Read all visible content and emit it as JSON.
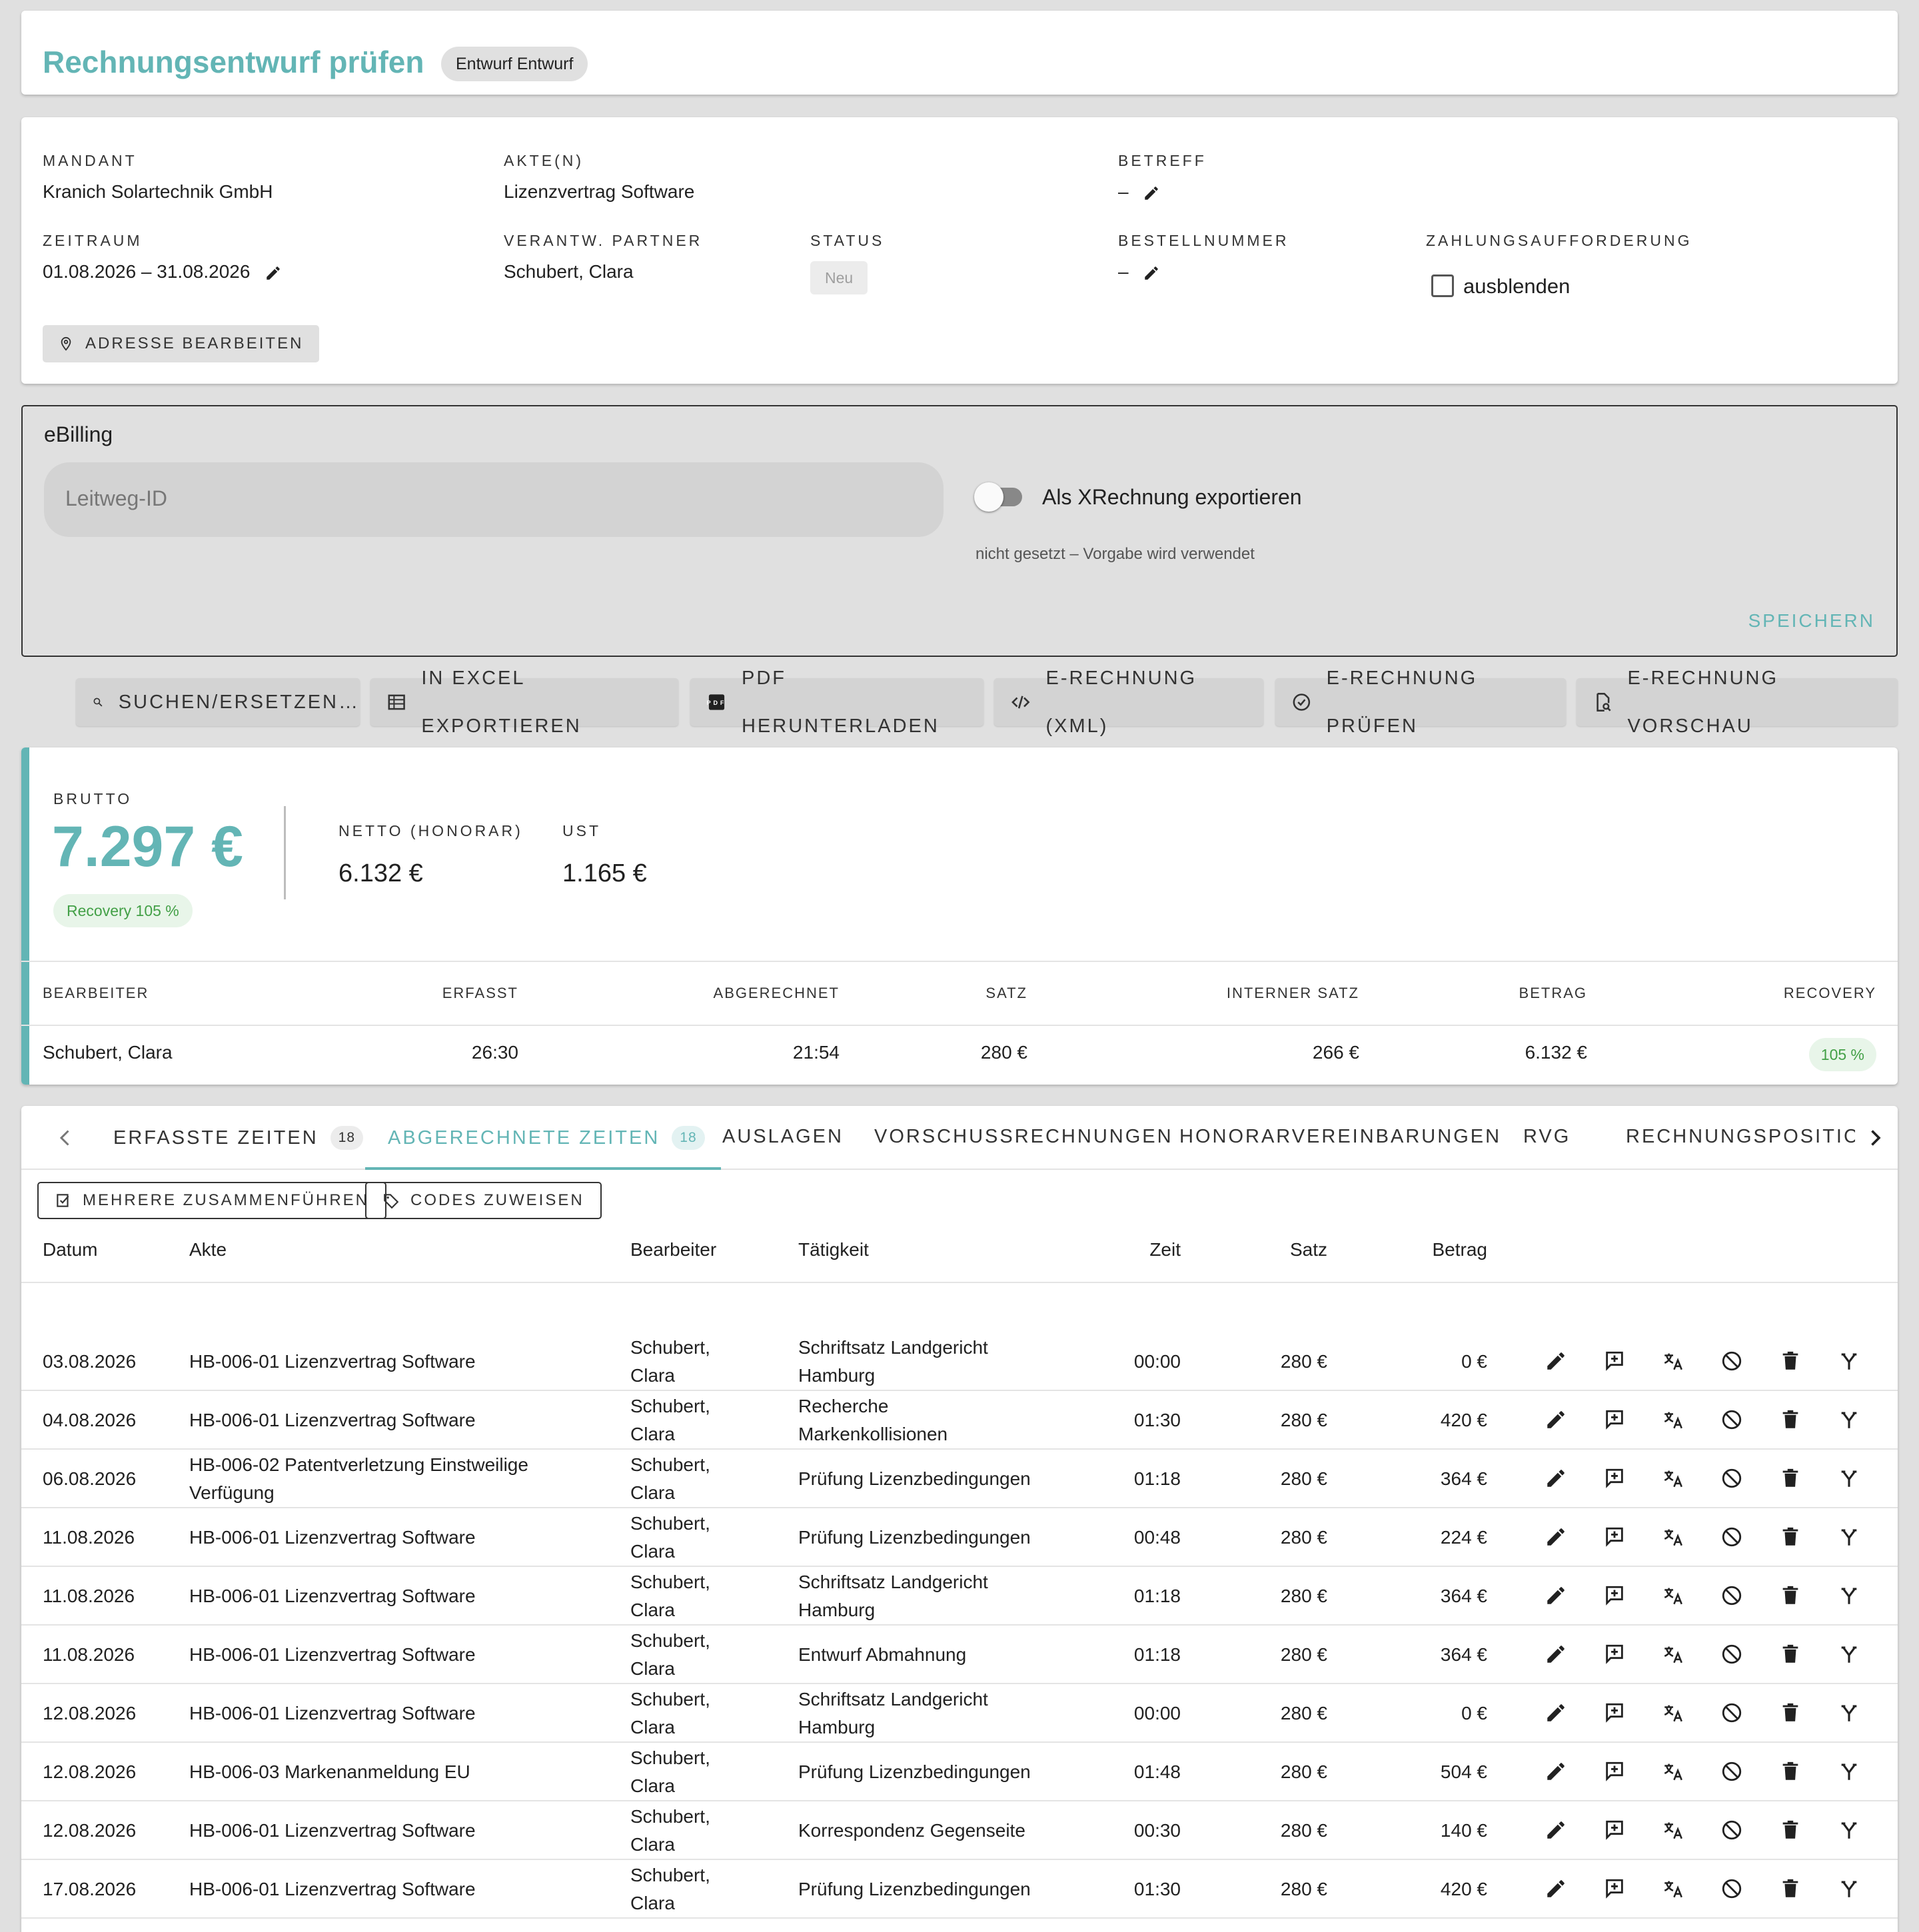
{
  "header": {
    "title": "Rechnungsentwurf prüfen",
    "draft_chip": "Entwurf Entwurf"
  },
  "meta": {
    "mandant_label": "MANDANT",
    "mandant_value": "Kranich Solartechnik GmbH",
    "akten_label": "AKTE(N)",
    "akten_value": "Lizenzvertrag Software",
    "betreff_label": "BETREFF",
    "betreff_value": "–",
    "zeitraum_label": "ZEITRAUM",
    "zeitraum_value": "01.08.2026 – 31.08.2026",
    "partner_label": "VERANTW. PARTNER",
    "partner_value": "Schubert, Clara",
    "status_label": "STATUS",
    "status_value": "Neu",
    "bestell_label": "BESTELLNUMMER",
    "bestell_value": "–",
    "zahlung_label": "ZAHLUNGSAUFFORDERUNG",
    "zahlung_checkbox_label": "ausblenden",
    "address_button": "ADRESSE BEARBEITEN"
  },
  "ebilling": {
    "title": "eBilling",
    "leitweg_placeholder": "Leitweg-ID",
    "xrechnung_label": "Als XRechnung exportieren",
    "xrechnung_hint": "nicht gesetzt – Vorgabe wird verwendet",
    "save_label": "SPEICHERN"
  },
  "toolbar": {
    "search_replace": "SUCHEN/ERSETZEN…",
    "excel_export": "IN EXCEL EXPORTIEREN",
    "pdf_download": "PDF HERUNTERLADEN",
    "erechnung_xml": "E-RECHNUNG (XML)",
    "erechnung_check": "E-RECHNUNG PRÜFEN",
    "erechnung_preview": "E-RECHNUNG VORSCHAU"
  },
  "totals": {
    "brutto_label": "BRUTTO",
    "brutto_value": "7.297 €",
    "recovery_chip": "Recovery 105 %",
    "netto_label": "NETTO (HONORAR)",
    "netto_value": "6.132 €",
    "ust_label": "UST",
    "ust_value": "1.165 €",
    "columns": [
      "BEARBEITER",
      "ERFASST",
      "ABGERECHNET",
      "SATZ",
      "INTERNER SATZ",
      "BETRAG",
      "RECOVERY"
    ],
    "row": {
      "bearbeiter": "Schubert, Clara",
      "erfasst": "26:30",
      "abgerechnet": "21:54",
      "satz": "280 €",
      "interner_satz": "266 €",
      "betrag": "6.132 €",
      "recovery": "105 %"
    }
  },
  "tabs": [
    {
      "label": "ERFASSTE ZEITEN",
      "count": "18"
    },
    {
      "label": "ABGERECHNETE ZEITEN",
      "count": "18"
    },
    {
      "label": "AUSLAGEN"
    },
    {
      "label": "VORSCHUSSRECHNUNGEN"
    },
    {
      "label": "HONORARVEREINBARUNGEN"
    },
    {
      "label": "RVG"
    },
    {
      "label": "RECHNUNGSPOSITIC"
    }
  ],
  "actions": {
    "merge": "MEHRERE ZUSAMMENFÜHREN",
    "codes": "CODES ZUWEISEN"
  },
  "table": {
    "headers": {
      "datum": "Datum",
      "akte": "Akte",
      "bearbeiter": "Bearbeiter",
      "taetigkeit": "Tätigkeit",
      "zeit": "Zeit",
      "satz": "Satz",
      "betrag": "Betrag"
    },
    "rows": [
      {
        "datum": "03.08.2026",
        "akte": "HB-006-01 Lizenzvertrag Software",
        "bearbeiter": "Schubert, Clara",
        "taetigkeit": "Schriftsatz Landgericht Hamburg",
        "zeit": "00:00",
        "satz": "280 €",
        "betrag": "0 €"
      },
      {
        "datum": "04.08.2026",
        "akte": "HB-006-01 Lizenzvertrag Software",
        "bearbeiter": "Schubert, Clara",
        "taetigkeit": "Recherche Markenkollisionen",
        "zeit": "01:30",
        "satz": "280 €",
        "betrag": "420 €"
      },
      {
        "datum": "06.08.2026",
        "akte": "HB-006-02 Patentverletzung Einstweilige Verfügung",
        "bearbeiter": "Schubert, Clara",
        "taetigkeit": "Prüfung Lizenzbedingungen",
        "zeit": "01:18",
        "satz": "280 €",
        "betrag": "364 €"
      },
      {
        "datum": "11.08.2026",
        "akte": "HB-006-01 Lizenzvertrag Software",
        "bearbeiter": "Schubert, Clara",
        "taetigkeit": "Prüfung Lizenzbedingungen",
        "zeit": "00:48",
        "satz": "280 €",
        "betrag": "224 €"
      },
      {
        "datum": "11.08.2026",
        "akte": "HB-006-01 Lizenzvertrag Software",
        "bearbeiter": "Schubert, Clara",
        "taetigkeit": "Schriftsatz Landgericht Hamburg",
        "zeit": "01:18",
        "satz": "280 €",
        "betrag": "364 €"
      },
      {
        "datum": "11.08.2026",
        "akte": "HB-006-01 Lizenzvertrag Software",
        "bearbeiter": "Schubert, Clara",
        "taetigkeit": "Entwurf Abmahnung",
        "zeit": "01:18",
        "satz": "280 €",
        "betrag": "364 €"
      },
      {
        "datum": "12.08.2026",
        "akte": "HB-006-01 Lizenzvertrag Software",
        "bearbeiter": "Schubert, Clara",
        "taetigkeit": "Schriftsatz Landgericht Hamburg",
        "zeit": "00:00",
        "satz": "280 €",
        "betrag": "0 €"
      },
      {
        "datum": "12.08.2026",
        "akte": "HB-006-03 Markenanmeldung EU",
        "bearbeiter": "Schubert, Clara",
        "taetigkeit": "Prüfung Lizenzbedingungen",
        "zeit": "01:48",
        "satz": "280 €",
        "betrag": "504 €"
      },
      {
        "datum": "12.08.2026",
        "akte": "HB-006-01 Lizenzvertrag Software",
        "bearbeiter": "Schubert, Clara",
        "taetigkeit": "Korrespondenz Gegenseite",
        "zeit": "00:30",
        "satz": "280 €",
        "betrag": "140 €"
      },
      {
        "datum": "17.08.2026",
        "akte": "HB-006-01 Lizenzvertrag Software",
        "bearbeiter": "Schubert, Clara",
        "taetigkeit": "Prüfung Lizenzbedingungen",
        "zeit": "01:30",
        "satz": "280 €",
        "betrag": "420 €"
      }
    ],
    "row_icons": [
      "edit-icon",
      "comment-add-icon",
      "translate-icon",
      "block-icon",
      "delete-icon",
      "merge-icon"
    ]
  },
  "colors": {
    "accent": "#63b5b5",
    "recovery_green": "#43a047",
    "recovery_bg": "#e8f5e9"
  }
}
